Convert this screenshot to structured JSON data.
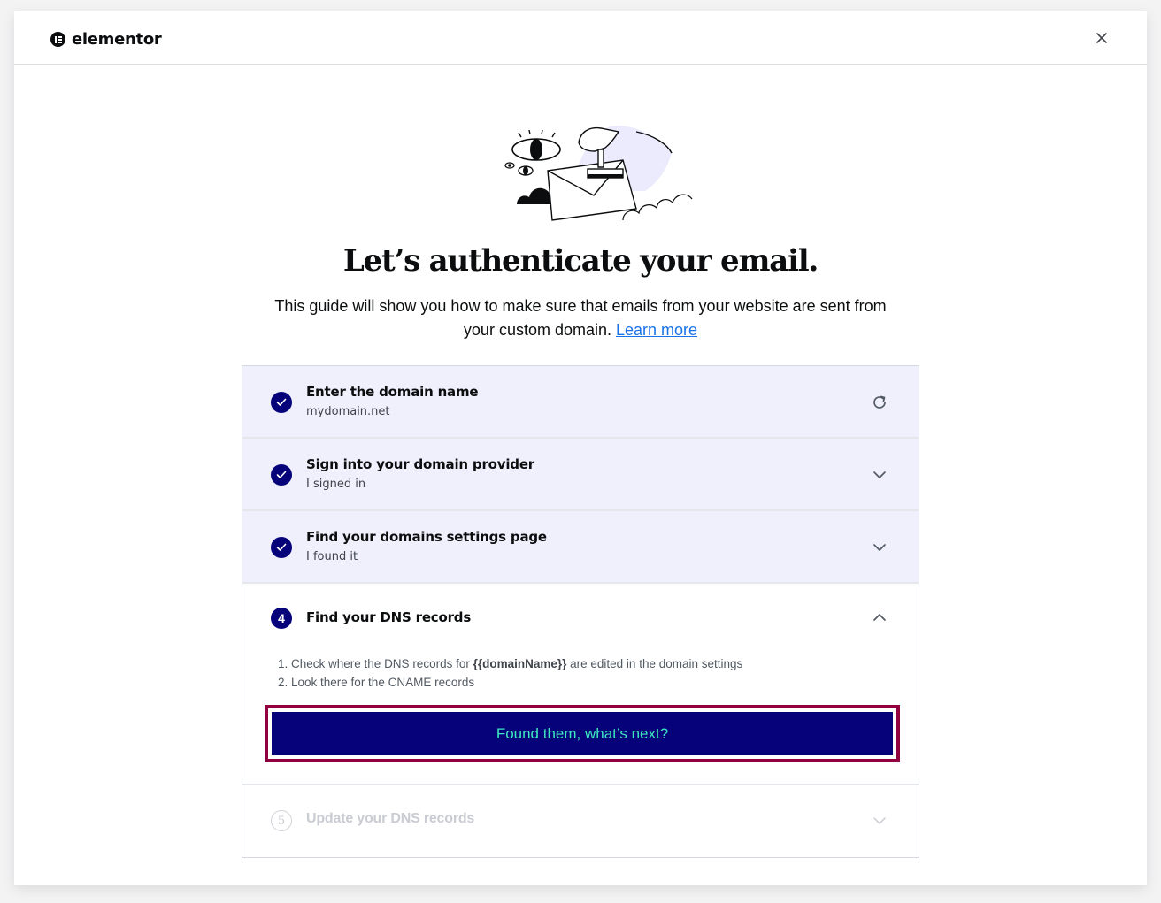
{
  "header": {
    "brand": "elementor",
    "close_icon": "close-icon"
  },
  "hero": {
    "illustration": "email-authentication-illustration",
    "title": "Let’s authenticate your email.",
    "subtitle": "This guide will show you how to make sure that emails from your website are sent from your custom domain.",
    "learn_more": "Learn more"
  },
  "steps": [
    {
      "state": "completed",
      "title": "Enter the domain name",
      "subtitle": "mydomain.net",
      "action_icon": "refresh-icon"
    },
    {
      "state": "completed",
      "title": "Sign into your domain provider",
      "subtitle": "I signed in",
      "action_icon": "chevron-down-icon"
    },
    {
      "state": "completed",
      "title": "Find your domains settings page",
      "subtitle": "I found it",
      "action_icon": "chevron-down-icon"
    },
    {
      "state": "active",
      "number": "4",
      "title": "Find your DNS records",
      "action_icon": "chevron-up-icon",
      "instructions": [
        {
          "prefix": "1. Check where the DNS records for ",
          "bold": "{{domainName}}",
          "suffix": " are edited in the domain settings"
        },
        {
          "prefix": "2. Look there for the CNAME records",
          "bold": "",
          "suffix": ""
        }
      ],
      "button_label": "Found them, what’s next?"
    },
    {
      "state": "locked",
      "number": "5",
      "title": "Update your DNS records",
      "action_icon": "chevron-down-icon"
    }
  ],
  "colors": {
    "primary": "#06037a",
    "accent_text": "#3de5c1",
    "focus_outline": "#93003f",
    "completed_bg": "#f0f0fd",
    "link": "#1a73e8"
  }
}
